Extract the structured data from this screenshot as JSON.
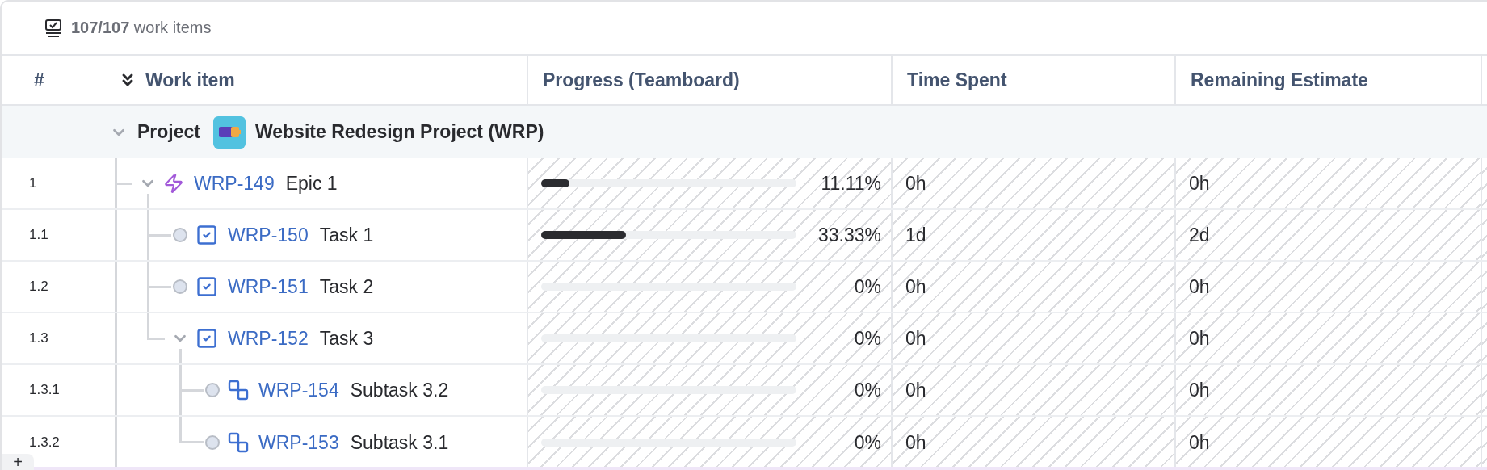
{
  "summary": {
    "count": "107/107",
    "label": "work items"
  },
  "columns": [
    {
      "label": "#"
    },
    {
      "label": "Work item"
    },
    {
      "label": "Progress (Teamboard)"
    },
    {
      "label": "Time Spent"
    },
    {
      "label": "Remaining Estimate"
    }
  ],
  "project": {
    "label": "Project",
    "name": "Website Redesign Project (WRP)",
    "expanded": true
  },
  "items": [
    {
      "number": "1",
      "kind": "epic",
      "key": "WRP-149",
      "summary": "Epic 1",
      "expanded": true,
      "level": 0.1111,
      "progress": "11.11%",
      "time_spent": "0h",
      "remaining": "0h",
      "children": [
        {
          "number": "1.1",
          "kind": "task",
          "key": "WRP-150",
          "summary": "Task 1",
          "level": 0.3333,
          "progress": "33.33%",
          "time_spent": "1d",
          "remaining": "2d"
        },
        {
          "number": "1.2",
          "kind": "task",
          "key": "WRP-151",
          "summary": "Task 2",
          "progress": "0%",
          "time_spent": "0h",
          "remaining": "0h"
        },
        {
          "number": "1.3",
          "kind": "task",
          "key": "WRP-152",
          "summary": "Task 3",
          "expanded": true,
          "progress": "0%",
          "time_spent": "0h",
          "remaining": "0h",
          "children": [
            {
              "number": "1.3.1",
              "kind": "subtask",
              "key": "WRP-154",
              "summary": "Subtask 3.2",
              "progress": "0%",
              "time_spent": "0h",
              "remaining": "0h"
            },
            {
              "number": "1.3.2",
              "kind": "subtask",
              "key": "WRP-153",
              "summary": "Subtask 3.1",
              "progress": "0%",
              "time_spent": "0h",
              "remaining": "0h"
            }
          ]
        }
      ]
    }
  ],
  "add_button": "+"
}
